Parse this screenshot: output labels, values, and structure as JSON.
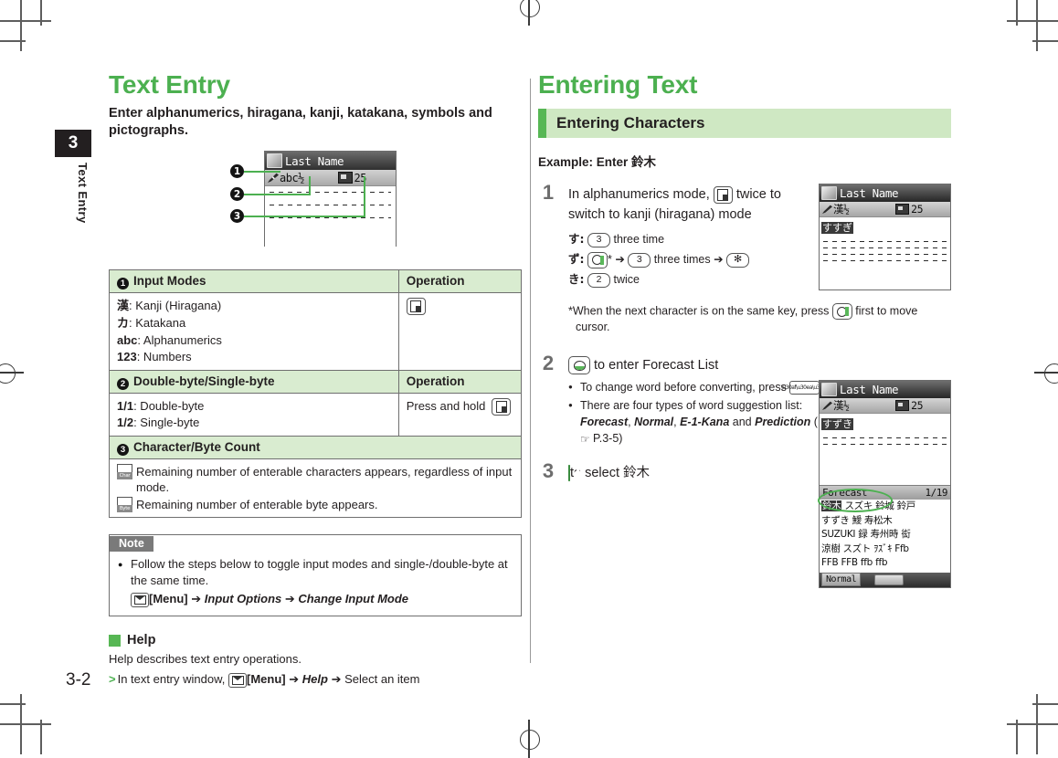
{
  "page": {
    "number": "3-2",
    "chapter_number": "3",
    "chapter_label": "Text Entry"
  },
  "left": {
    "title": "Text Entry",
    "subtitle": "Enter alphanumerics, hiragana, kanji, katakana, symbols and pictographs.",
    "figure": {
      "screen_title": "Last Name",
      "mode_text": "abc½",
      "count_text": "25",
      "callouts": [
        "1",
        "2",
        "3"
      ]
    },
    "table": {
      "section1_header": "Input Modes",
      "section1_num": "1",
      "operation_header": "Operation",
      "modes": [
        {
          "sym": "漢",
          "desc": ": Kanji (Hiragana)"
        },
        {
          "sym": "カ",
          "desc": ": Katakana"
        },
        {
          "sym": "abc",
          "desc": ": Alphanumerics"
        },
        {
          "sym": "123",
          "desc": ": Numbers"
        }
      ],
      "section2_header": "Double-byte/Single-byte",
      "section2_num": "2",
      "operation_header2": "Operation",
      "bytes": [
        {
          "sym": "1/1",
          "desc": ": Double-byte"
        },
        {
          "sym": "1/2",
          "desc": ": Single-byte"
        }
      ],
      "byte_operation": "Press and hold",
      "section3_header": "Character/Byte Count",
      "section3_num": "3",
      "counts": [
        {
          "icon_label": "Char",
          "text": "Remaining number of enterable characters appears, regardless of input mode."
        },
        {
          "icon_label": "Byte",
          "text": "Remaining number of enterable byte appears."
        }
      ]
    },
    "note": {
      "label": "Note",
      "text": "Follow the steps below to toggle input modes and single-/double-byte at the same time.",
      "menu_label": "[Menu]",
      "path": "Input Options",
      "path2": "Change Input Mode",
      "arrow": "➔"
    },
    "help": {
      "heading": "Help",
      "line": "Help describes text entry operations.",
      "marker": ">",
      "prefix": "In text entry window,",
      "menu_label": "[Menu]",
      "path": "Help",
      "tail": "Select an item",
      "arrow": "➔"
    }
  },
  "right": {
    "title": "Entering Text",
    "band": "Entering Characters",
    "example": "Example: Enter 鈴木",
    "steps": [
      {
        "num": "1",
        "text_a": "In alphanumerics mode,",
        "text_b": "twice to switch to kanji (hiragana) mode",
        "substeps": [
          {
            "kana": "す:",
            "key": "3",
            "tail": "three time"
          },
          {
            "kana": "ず:",
            "key": "3",
            "tail": "three times",
            "star": "✻"
          },
          {
            "kana": "き:",
            "key": "2",
            "tail": "twice"
          }
        ],
        "footnote_a": "*When the next character is on the same key, press",
        "footnote_b": "first to move",
        "footnote_c": "cursor."
      },
      {
        "num": "2",
        "text_a": "to enter Forecast List",
        "bullets": [
          {
            "a": "To change word before converting, press",
            "b": "."
          },
          {
            "a": "There are four types of word suggestion list:",
            "i1": "Forecast",
            "i2": "Normal",
            "i3": "E-1-Kana",
            "and": "and",
            "i4": "Prediction",
            "ref": "P.3-5"
          }
        ]
      },
      {
        "num": "3",
        "text_a": "to select 鈴木"
      }
    ],
    "screen1": {
      "title": "Last Name",
      "mode": "漢½",
      "count": "25",
      "typed": "すすぎ"
    },
    "screen2": {
      "title": "Last Name",
      "mode": "漢½",
      "count": "25",
      "typed": "すずき",
      "list_label": "Forecast",
      "list_index": "1/19",
      "candidates": [
        [
          "鈴木",
          "スズキ",
          "鈴城",
          "鈴戸"
        ],
        [
          "すずき",
          "鱫",
          "寿松木"
        ],
        [
          "SUZUKI",
          "録",
          "寿州時",
          "衒"
        ],
        [
          "涼樹",
          "スズト",
          "ｦｽﾞｷ",
          "Ffb"
        ],
        [
          "FFB",
          "FFB",
          "ffb",
          "ffb"
        ]
      ],
      "soft_left": "Normal"
    }
  },
  "colors": {
    "green": "#4cb050",
    "band": "#cfe8c3",
    "band_bar": "#57b754",
    "table_header": "#d9ecd0",
    "ink": "#231f20"
  }
}
